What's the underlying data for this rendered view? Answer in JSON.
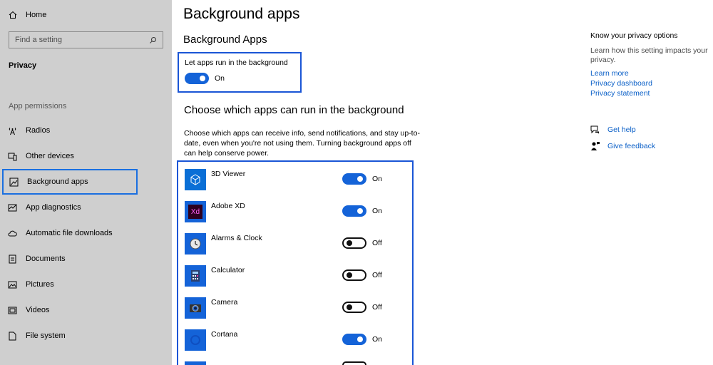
{
  "sidebar": {
    "home_label": "Home",
    "search_placeholder": "Find a setting",
    "section_title": "Privacy",
    "group_label": "App permissions",
    "items": [
      {
        "label": "Radios",
        "icon": "radio-tower-icon"
      },
      {
        "label": "Other devices",
        "icon": "devices-icon"
      },
      {
        "label": "Background apps",
        "icon": "background-apps-icon"
      },
      {
        "label": "App diagnostics",
        "icon": "diagnostics-icon"
      },
      {
        "label": "Automatic file downloads",
        "icon": "cloud-icon"
      },
      {
        "label": "Documents",
        "icon": "document-icon"
      },
      {
        "label": "Pictures",
        "icon": "picture-icon"
      },
      {
        "label": "Videos",
        "icon": "video-icon"
      },
      {
        "label": "File system",
        "icon": "file-icon"
      }
    ],
    "active_item": "Background apps"
  },
  "main": {
    "title": "Background apps",
    "subtitle": "Background Apps",
    "master_label": "Let apps run in the background",
    "master_state": "On",
    "choose_title": "Choose which apps can run in the background",
    "choose_desc": "Choose which apps can receive info, send notifications, and stay up-to-date, even when you're not using them. Turning background apps off can help conserve power.",
    "apps": [
      {
        "name": "3D Viewer",
        "state": "On",
        "on": true
      },
      {
        "name": "Adobe XD",
        "state": "On",
        "on": true
      },
      {
        "name": "Alarms & Clock",
        "state": "Off",
        "on": false
      },
      {
        "name": "Calculator",
        "state": "Off",
        "on": false
      },
      {
        "name": "Camera",
        "state": "Off",
        "on": false
      },
      {
        "name": "Cortana",
        "state": "On",
        "on": true
      }
    ],
    "adobe_icon_text": "Xd"
  },
  "right": {
    "title": "Know your privacy options",
    "desc": "Learn how this setting impacts your privacy.",
    "links": [
      "Learn more",
      "Privacy dashboard",
      "Privacy statement"
    ],
    "help": "Get help",
    "feedback": "Give feedback"
  },
  "colors": {
    "accent": "#1463d8",
    "highlight_border": "#1a55d6",
    "link": "#0a5fc7",
    "sidebar_bg": "#cfcfcf"
  }
}
